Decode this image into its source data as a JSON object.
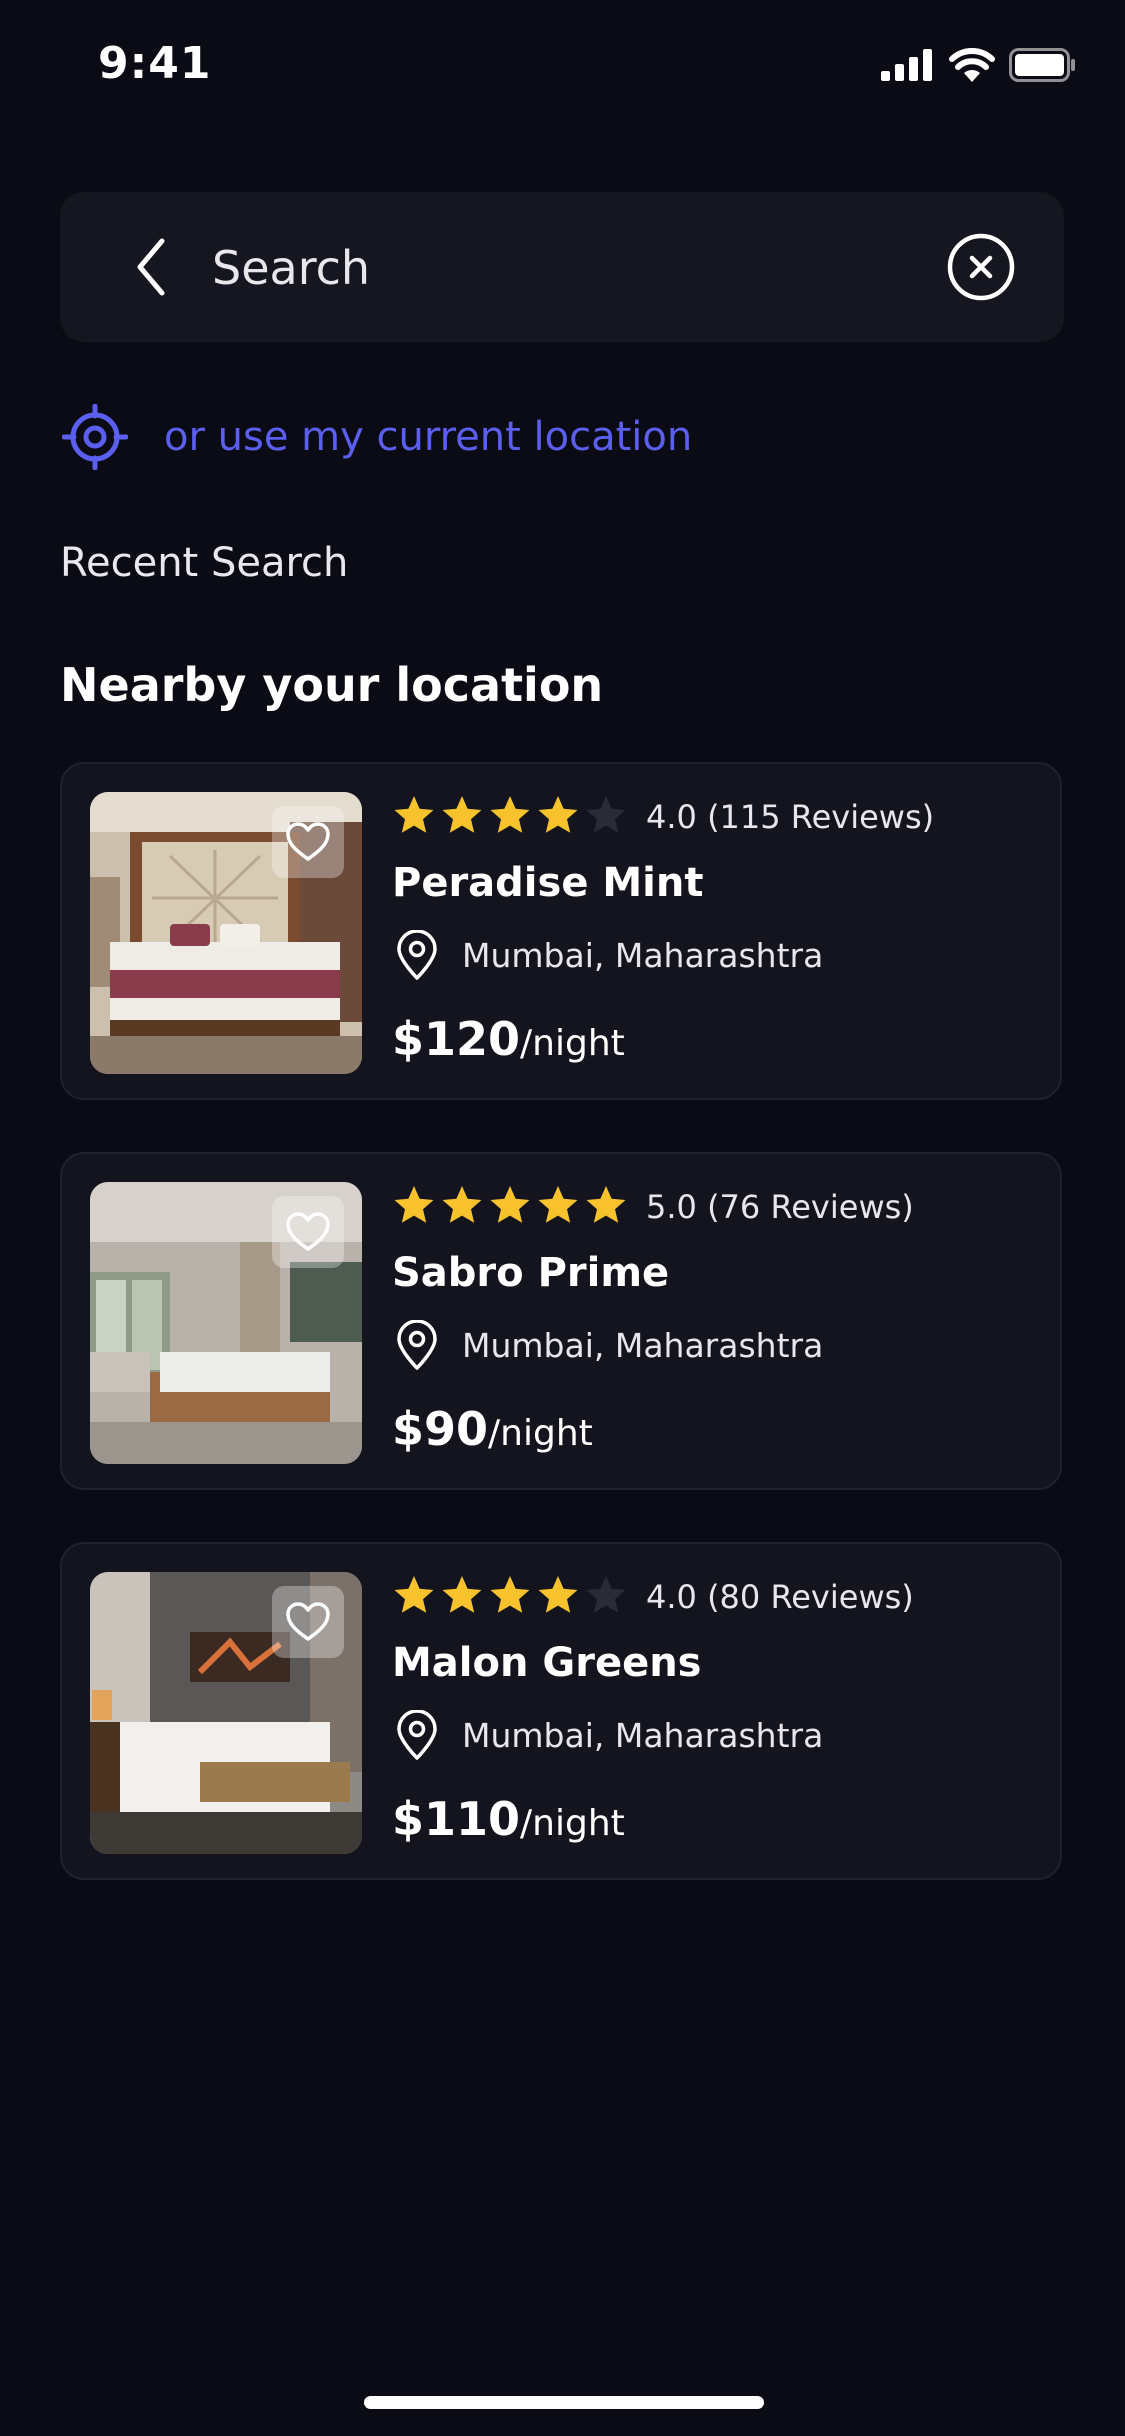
{
  "status_bar": {
    "time": "9:41"
  },
  "search": {
    "placeholder": "Search"
  },
  "location_link": "or use my current location",
  "recent_label": "Recent Search",
  "section_title": "Nearby your location",
  "colors": {
    "accent": "#5b5ff0",
    "star": "#f7c22c",
    "background": "#0b0b15",
    "card": "#13141e"
  },
  "hotels": [
    {
      "name": "Peradise Mint",
      "rating": 4,
      "rating_text": "4.0 (115 Reviews)",
      "location": "Mumbai, Maharashtra",
      "price": "$120",
      "unit": "/night"
    },
    {
      "name": "Sabro Prime",
      "rating": 5,
      "rating_text": "5.0 (76 Reviews)",
      "location": "Mumbai, Maharashtra",
      "price": "$90",
      "unit": "/night"
    },
    {
      "name": "Malon Greens",
      "rating": 4,
      "rating_text": "4.0 (80 Reviews)",
      "location": "Mumbai, Maharashtra",
      "price": "$110",
      "unit": "/night"
    }
  ]
}
